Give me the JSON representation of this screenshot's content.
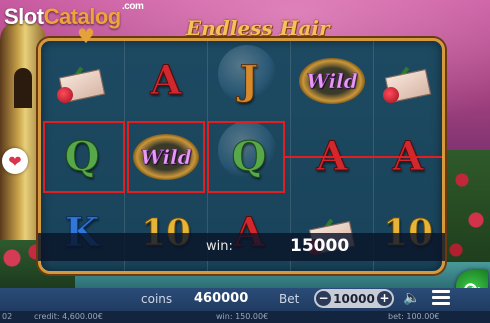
{
  "brand": {
    "logo_part1": "Slot",
    "logo_part2": "Catalog",
    "logo_suffix": ".com"
  },
  "game": {
    "title": "Endless Hair"
  },
  "reels": {
    "rows": [
      [
        "envelope",
        "A",
        "J",
        "Wild",
        "envelope"
      ],
      [
        "Q",
        "Wild",
        "Q",
        "A",
        "A"
      ],
      [
        "K",
        "10",
        "A",
        "envelope",
        "10"
      ]
    ],
    "wild_label": "Wild"
  },
  "win_bar": {
    "label": "win:",
    "value": "15000"
  },
  "hud": {
    "coins_label": "coins",
    "coins_value": "460000",
    "bet_label": "Bet",
    "bet_value": "10000",
    "bet_minus": "−",
    "bet_plus": "+"
  },
  "footer": {
    "clock": "02",
    "credit": "credit: 4,600.00€",
    "win": "win: 150.00€",
    "bet": "bet: 100.00€"
  },
  "icons": {
    "sound": "speaker-icon",
    "menu": "menu-icon",
    "spin": "spin-icon",
    "heart": "heart-icon"
  },
  "colors": {
    "win_highlight": "#e02020",
    "frame_gold": "#d69a3c",
    "spin_green": "#3ed04a"
  }
}
